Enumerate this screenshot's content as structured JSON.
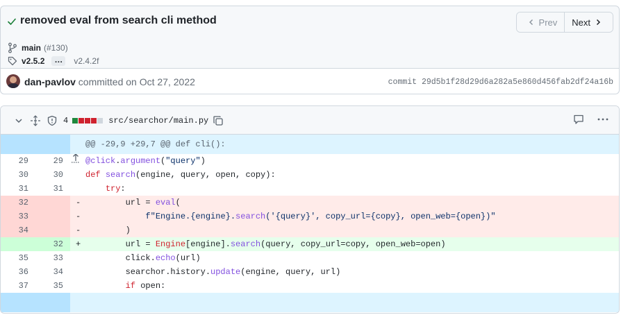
{
  "commit": {
    "title": "removed eval from search cli method",
    "branch": "main",
    "pr": "(#130)",
    "tag_primary": "v2.5.2",
    "tag_ellipsis": "…",
    "tag_secondary": "v2.4.2f",
    "author": "dan-pavlov",
    "action": " committed on Oct 27, 2022",
    "sha_label": "commit 29d5b1f28d29d6a282a5e860d456fab2df24a16b"
  },
  "nav": {
    "prev": "Prev",
    "next": "Next"
  },
  "file": {
    "changes": "4",
    "path": "src/searchor/main.py",
    "diffstat": [
      "#1f883d",
      "#cf222e",
      "#cf222e",
      "#cf222e",
      "#d0d7de"
    ]
  },
  "diff": {
    "hunk_header": "@@ -29,9 +29,7 @@ def cli():",
    "lines": [
      {
        "type": "ctx",
        "old": "29",
        "new": "29",
        "marker": "",
        "code": "@click.argument(\"query\")"
      },
      {
        "type": "ctx",
        "old": "30",
        "new": "30",
        "marker": "",
        "code": "def search(engine, query, open, copy):"
      },
      {
        "type": "ctx",
        "old": "31",
        "new": "31",
        "marker": "",
        "code": "    try:"
      },
      {
        "type": "del",
        "old": "32",
        "new": "",
        "marker": "-",
        "code": "        url = eval("
      },
      {
        "type": "del",
        "old": "33",
        "new": "",
        "marker": "-",
        "code": "            f\"Engine.{engine}.search('{query}', copy_url={copy}, open_web={open})\""
      },
      {
        "type": "del",
        "old": "34",
        "new": "",
        "marker": "-",
        "code": "        )"
      },
      {
        "type": "add",
        "old": "",
        "new": "32",
        "marker": "+",
        "code": "        url = Engine[engine].search(query, copy_url=copy, open_web=open)"
      },
      {
        "type": "ctx",
        "old": "35",
        "new": "33",
        "marker": "",
        "code": "        click.echo(url)"
      },
      {
        "type": "ctx",
        "old": "36",
        "new": "34",
        "marker": "",
        "code": "        searchor.history.update(engine, query, url)"
      },
      {
        "type": "ctx",
        "old": "37",
        "new": "35",
        "marker": "",
        "code": "        if open:"
      }
    ]
  }
}
